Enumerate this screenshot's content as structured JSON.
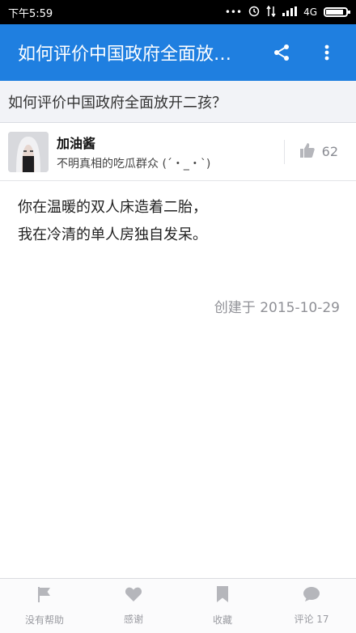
{
  "status_bar": {
    "time": "下午5:59",
    "network": "4G"
  },
  "app_bar": {
    "title": "如何评价中国政府全面放…",
    "share_icon": "share-icon",
    "more_icon": "more-vert-icon",
    "color": "#1f7fe0"
  },
  "question": {
    "title": "如何评价中国政府全面放开二孩？"
  },
  "author": {
    "name": "加油酱",
    "bio": "不明真相的吃瓜群众 (´・_・`)",
    "vote_count": "62"
  },
  "answer": {
    "lines": [
      "你在温暖的双人床造着二胎，",
      "我在冷清的单人房独自发呆。"
    ],
    "created": "创建于 2015-10-29"
  },
  "bottom_tabs": [
    {
      "label": "没有帮助",
      "icon": "flag-icon"
    },
    {
      "label": "感谢",
      "icon": "heart-icon"
    },
    {
      "label": "收藏",
      "icon": "bookmark-icon"
    },
    {
      "label": "评论 17",
      "icon": "comment-icon"
    }
  ]
}
